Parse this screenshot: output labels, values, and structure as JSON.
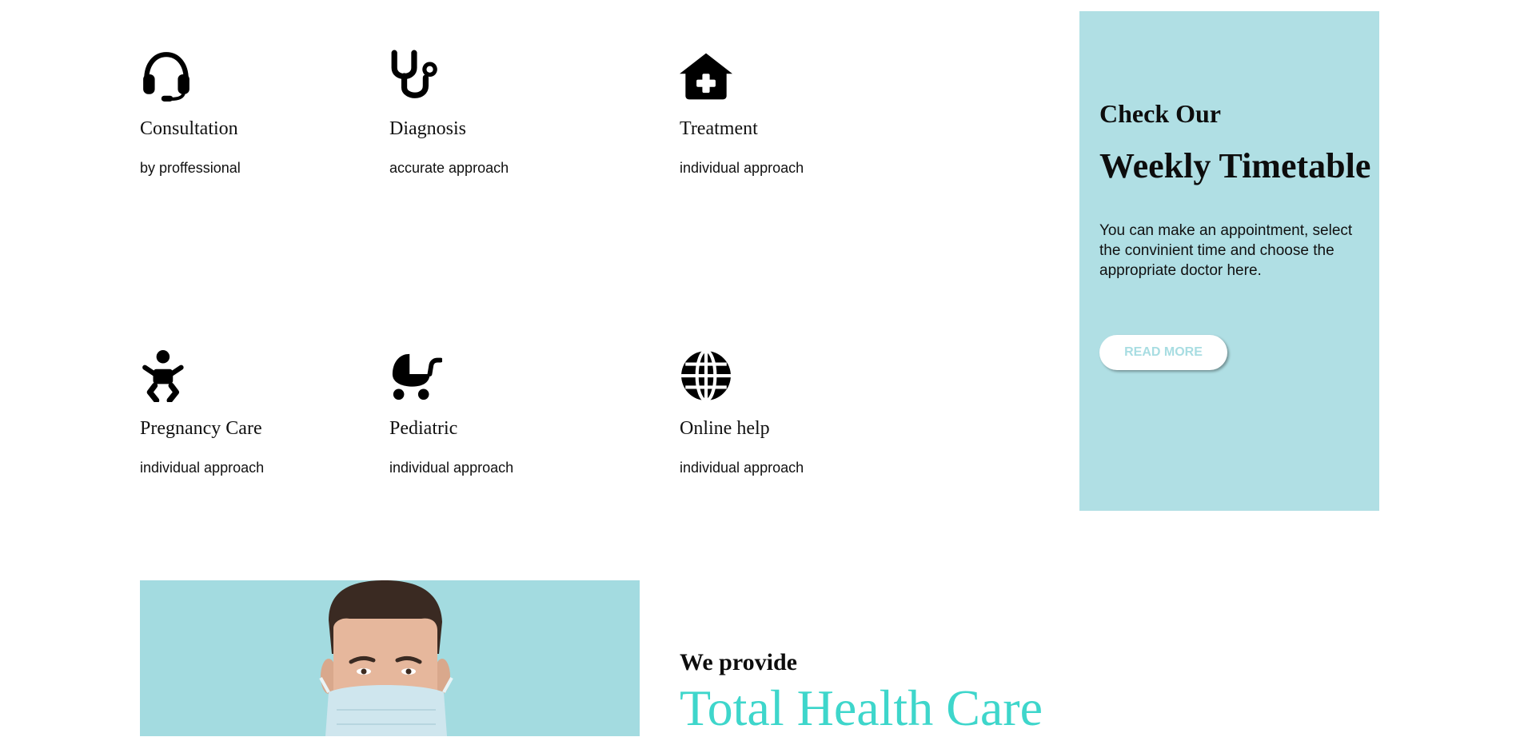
{
  "services": [
    {
      "title": "Consultation",
      "subtitle": "by proffessional",
      "icon": "headset-icon"
    },
    {
      "title": "Diagnosis",
      "subtitle": "accurate approach",
      "icon": "stethoscope-icon"
    },
    {
      "title": "Treatment",
      "subtitle": "individual approach",
      "icon": "clinic-house-icon"
    },
    {
      "title": "Pregnancy Care",
      "subtitle": "individual approach",
      "icon": "baby-icon"
    },
    {
      "title": "Pediatric",
      "subtitle": "individual approach",
      "icon": "baby-carriage-icon"
    },
    {
      "title": "Online help",
      "subtitle": "individual approach",
      "icon": "globe-icon"
    }
  ],
  "timetable": {
    "kicker": "Check Our",
    "heading": "Weekly Timetable",
    "description": "You can make an appointment, select the convinient time and choose the appropriate doctor here.",
    "button_label": "READ MORE",
    "background": "#b0dfe4",
    "button_text_color": "#a8dde2"
  },
  "about": {
    "kicker": "We provide",
    "headline": "Total Health Care",
    "headline_color": "#3ed6cb",
    "photo_background": "#a3dbe0"
  }
}
